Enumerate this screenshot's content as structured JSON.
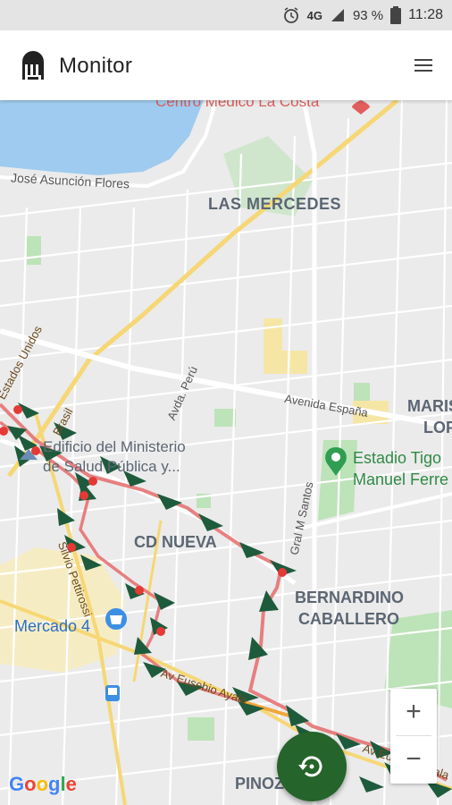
{
  "status_bar": {
    "signal_type": "4G",
    "battery": "93 %",
    "time": "11:28"
  },
  "app_bar": {
    "title": "Monitor"
  },
  "map": {
    "labels": {
      "centro_medico": "Centro Médico La Costa",
      "jose_asuncion": "José Asunción Flores",
      "las_mercedes": "LAS MERCEDES",
      "estados_unidos": "Estados Unidos",
      "brasil": "Brasil",
      "avda_peru": "Avda. Perú",
      "avenida_espana": "Avenida España",
      "maris": "MARIS",
      "lop": "LOP",
      "edificio_line1": "Edificio del Ministerio",
      "edificio_line2": "de Salud Pública y...",
      "estadio_line1": "Estadio Tigo",
      "estadio_line2": "Manuel Ferre",
      "gral_santos": "Gral M Santos",
      "cd_nueva": "CD NUEVA",
      "silvio": "Silvio Pettirossi",
      "bernardino_line1": "BERNARDINO",
      "bernardino_line2": "CABALLERO",
      "mercado": "Mercado 4",
      "eusebio": "Av Eusebio Ayala",
      "eusebio2": "Av Eusebio Ayala",
      "pinoza": "PINOZ",
      "google": "Google"
    },
    "zoom_in": "+",
    "zoom_out": "−",
    "colors": {
      "track_marker": "#1e5b3d",
      "track_line": "#e57373",
      "stop_dot": "#e53935",
      "water": "#9ecbef",
      "park": "#bde3b8",
      "road_major": "#f6d775",
      "fab": "#25642a"
    }
  }
}
